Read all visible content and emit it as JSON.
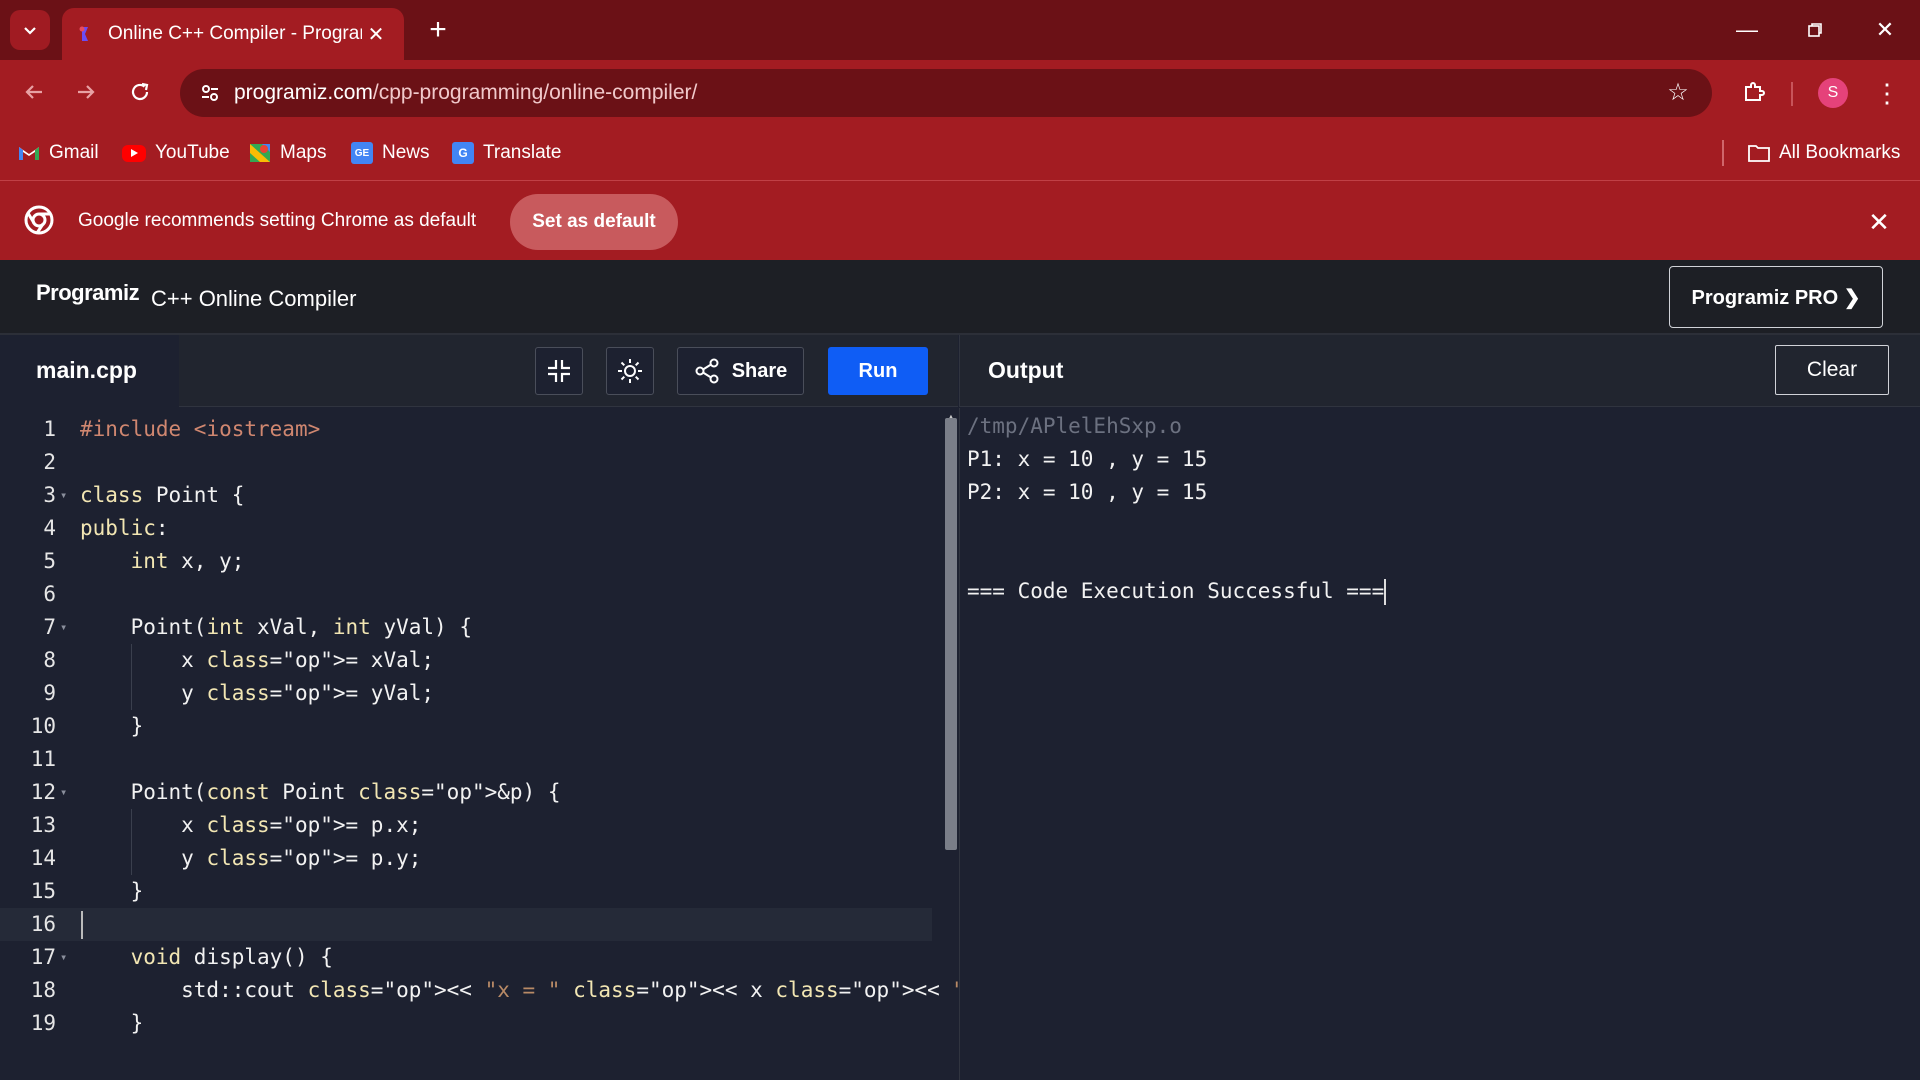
{
  "browser": {
    "tab_title": "Online C++ Compiler - Programiz",
    "url_host": "programiz.com",
    "url_path": "/cpp-programming/online-compiler/",
    "profile_initial": "S",
    "bookmarks": [
      {
        "label": "Gmail",
        "icon": "gmail-icon"
      },
      {
        "label": "YouTube",
        "icon": "youtube-icon"
      },
      {
        "label": "Maps",
        "icon": "maps-icon"
      },
      {
        "label": "News",
        "icon": "news-icon"
      },
      {
        "label": "Translate",
        "icon": "translate-icon"
      }
    ],
    "all_bookmarks_label": "All Bookmarks",
    "infobar": {
      "text": "Google recommends setting Chrome as default",
      "button_label": "Set as default"
    }
  },
  "site": {
    "logo": "Programiz",
    "title": "C++ Online Compiler",
    "pro_button": "Programiz PRO ❯"
  },
  "editor": {
    "filename": "main.cpp",
    "share_label": "Share",
    "run_label": "Run",
    "lines": [
      "#include <iostream>",
      "",
      "class Point {",
      "public:",
      "    int x, y;",
      "",
      "    Point(int xVal, int yVal) {",
      "        x = xVal;",
      "        y = yVal;",
      "    }",
      "",
      "    Point(const Point &p) {",
      "        x = p.x;",
      "        y = p.y;",
      "    }",
      "",
      "    void display() {",
      "        std::cout << \"x = \" << x << \" , y = \" << y << std::endl;",
      "    }"
    ]
  },
  "output": {
    "title": "Output",
    "clear_label": "Clear",
    "lines": [
      "/tmp/APlelEhSxp.o",
      "P1: x = 10 , y = 15",
      "P2: x = 10 , y = 15",
      "",
      "",
      "=== Code Execution Successful ==="
    ]
  },
  "colors": {
    "chrome_frame": "#6b1116",
    "chrome_toolbar": "#a31c22",
    "run_button": "#0f5df5",
    "editor_bg": "#1d2130"
  }
}
